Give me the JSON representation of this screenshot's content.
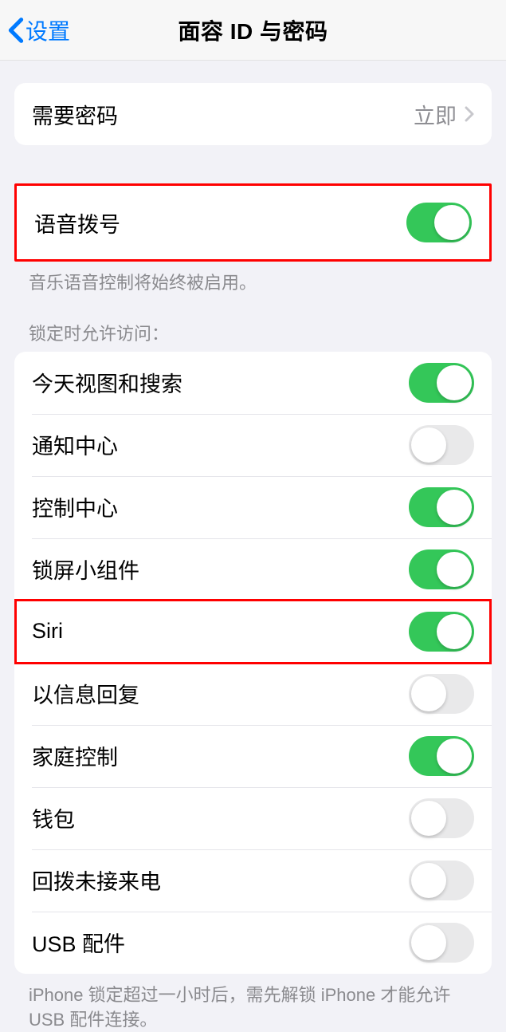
{
  "nav": {
    "back_label": "设置",
    "title": "面容 ID 与密码"
  },
  "require_passcode": {
    "label": "需要密码",
    "value": "立即"
  },
  "voice_dial": {
    "label": "语音拨号",
    "footnote": "音乐语音控制将始终被启用。"
  },
  "lock_header": "锁定时允许访问：",
  "lock_items": {
    "today": "今天视图和搜索",
    "notif": "通知中心",
    "control": "控制中心",
    "widgets": "锁屏小组件",
    "siri": "Siri",
    "reply": "以信息回复",
    "home": "家庭控制",
    "wallet": "钱包",
    "callback": "回拨未接来电",
    "usb": "USB 配件"
  },
  "usb_footnote": "iPhone 锁定超过一小时后，需先解锁 iPhone 才能允许 USB 配件连接。",
  "toggle_states": {
    "voice_dial": true,
    "today": true,
    "notif": false,
    "control": true,
    "widgets": true,
    "siri": true,
    "reply": false,
    "home": true,
    "wallet": false,
    "callback": false,
    "usb": false
  }
}
